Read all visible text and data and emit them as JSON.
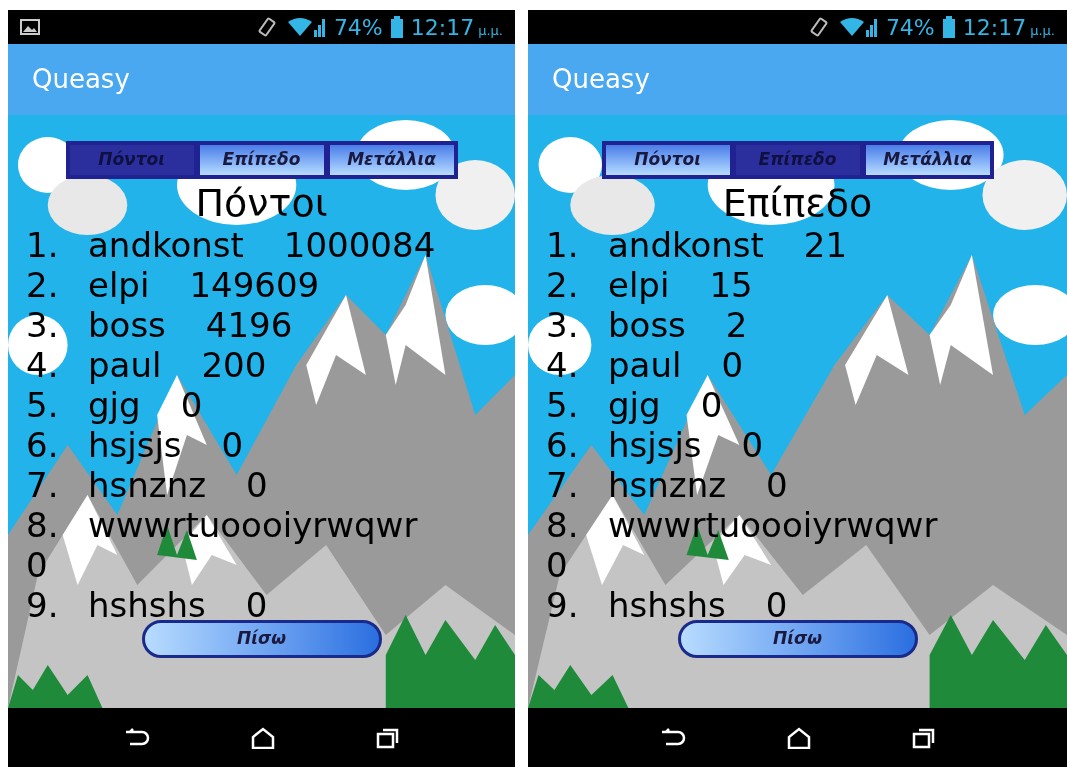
{
  "screens": [
    {
      "status_bar": {
        "has_notification": true,
        "battery": "74%",
        "time": "12:17",
        "time_suffix": "μ.μ."
      },
      "app_title": "Queasy",
      "tabs": [
        {
          "label": "Πόντοι",
          "selected": true
        },
        {
          "label": "Επίπεδο",
          "selected": false
        },
        {
          "label": "Μετάλλια",
          "selected": false
        }
      ],
      "heading": "Πόντοι",
      "rows": [
        {
          "rank": "1.",
          "name": "andkonst",
          "score": "1000084"
        },
        {
          "rank": "2.",
          "name": "elpi",
          "score": "149609"
        },
        {
          "rank": "3.",
          "name": "boss",
          "score": "4196"
        },
        {
          "rank": "4.",
          "name": "paul",
          "score": "200"
        },
        {
          "rank": "5.",
          "name": "gjg",
          "score": "0"
        },
        {
          "rank": "6.",
          "name": "hsjsjs",
          "score": "0"
        },
        {
          "rank": "7.",
          "name": "hsnznz",
          "score": "0"
        },
        {
          "rank": "8.",
          "name": "wwwrtuoooiyrwqwr",
          "score": "0"
        },
        {
          "rank": "9.",
          "name": "hshshs",
          "score": "0"
        }
      ],
      "back_button": "Πίσω"
    },
    {
      "status_bar": {
        "has_notification": false,
        "battery": "74%",
        "time": "12:17",
        "time_suffix": "μ.μ."
      },
      "app_title": "Queasy",
      "tabs": [
        {
          "label": "Πόντοι",
          "selected": false
        },
        {
          "label": "Επίπεδο",
          "selected": true
        },
        {
          "label": "Μετάλλια",
          "selected": false
        }
      ],
      "heading": "Επίπεδο",
      "rows": [
        {
          "rank": "1.",
          "name": "andkonst",
          "score": "21"
        },
        {
          "rank": "2.",
          "name": "elpi",
          "score": "15"
        },
        {
          "rank": "3.",
          "name": "boss",
          "score": "2"
        },
        {
          "rank": "4.",
          "name": "paul",
          "score": "0"
        },
        {
          "rank": "5.",
          "name": "gjg",
          "score": "0"
        },
        {
          "rank": "6.",
          "name": "hsjsjs",
          "score": "0"
        },
        {
          "rank": "7.",
          "name": "hsnznz",
          "score": "0"
        },
        {
          "rank": "8.",
          "name": "wwwrtuoooiyrwqwr",
          "score": "0"
        },
        {
          "rank": "9.",
          "name": "hshshs",
          "score": "0"
        }
      ],
      "back_button": "Πίσω"
    }
  ]
}
